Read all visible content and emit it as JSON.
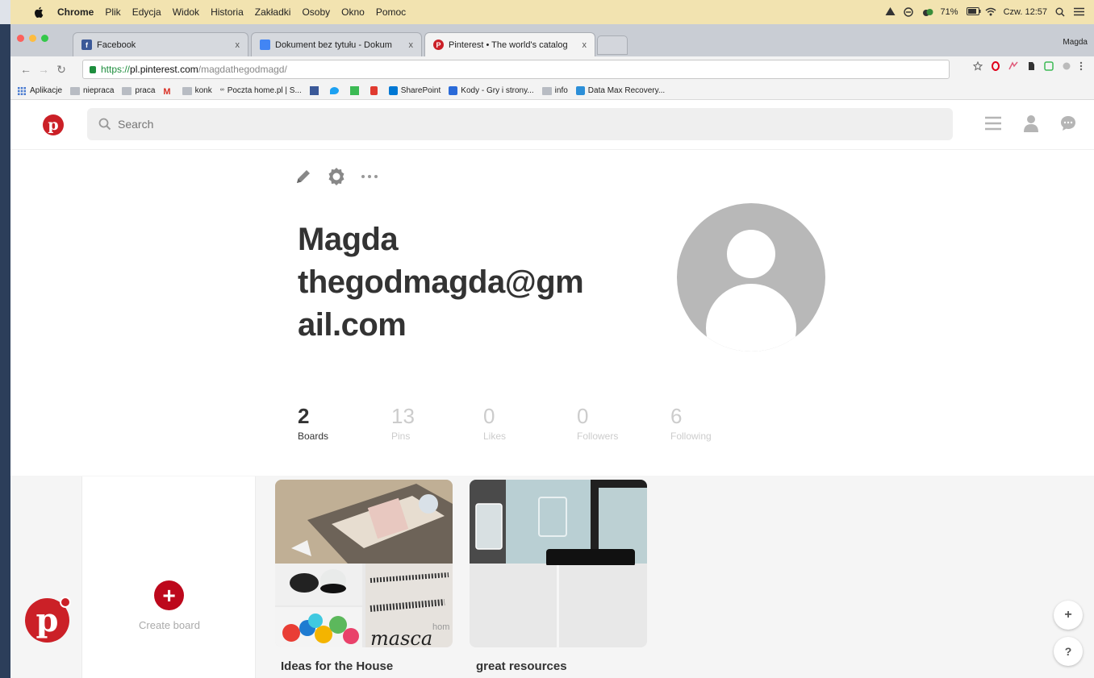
{
  "menubar": {
    "app": "Chrome",
    "items": [
      "Plik",
      "Edycja",
      "Widok",
      "Historia",
      "Zakładki",
      "Osoby",
      "Okno",
      "Pomoc"
    ],
    "battery": "71%",
    "clock": "Czw. 12:57"
  },
  "tabs": [
    {
      "title": "Facebook",
      "close": "x",
      "favicon_color": "#3b5998",
      "favicon_letter": "f"
    },
    {
      "title": "Dokument bez tytułu - Dokum",
      "close": "x",
      "favicon_color": "#4285f4",
      "favicon_letter": ""
    },
    {
      "title": "Pinterest • The world's catalog",
      "close": "x",
      "favicon_color": "#cb2027",
      "favicon_letter": "P"
    }
  ],
  "profile_name": "Magda",
  "address": {
    "scheme": "https://",
    "host": "pl.pinterest.com",
    "path": "/magdathegodmagd/"
  },
  "bookmarks": [
    "Aplikacje",
    "niepraca",
    "praca",
    "konk",
    "Poczta home.pl | S...",
    "SharePoint",
    "Kody - Gry i strony...",
    "info",
    "Data Max Recovery..."
  ],
  "search": {
    "placeholder": "Search"
  },
  "profile": {
    "display_name": "Magda thegodmagda@gmail.com"
  },
  "stats": [
    {
      "num": "2",
      "label": "Boards"
    },
    {
      "num": "13",
      "label": "Pins"
    },
    {
      "num": "0",
      "label": "Likes"
    },
    {
      "num": "0",
      "label": "Followers"
    },
    {
      "num": "6",
      "label": "Following"
    }
  ],
  "create_board": {
    "icon": "+",
    "label": "Create board"
  },
  "boards": [
    {
      "title": "Ideas for the House",
      "cover_text": "masca",
      "cover_text_small": "hom"
    },
    {
      "title": "great resources"
    }
  ],
  "fab": {
    "plus": "+",
    "help": "?"
  },
  "colors": {
    "pinterest_red": "#cb2027",
    "create_red": "#bd081c"
  }
}
